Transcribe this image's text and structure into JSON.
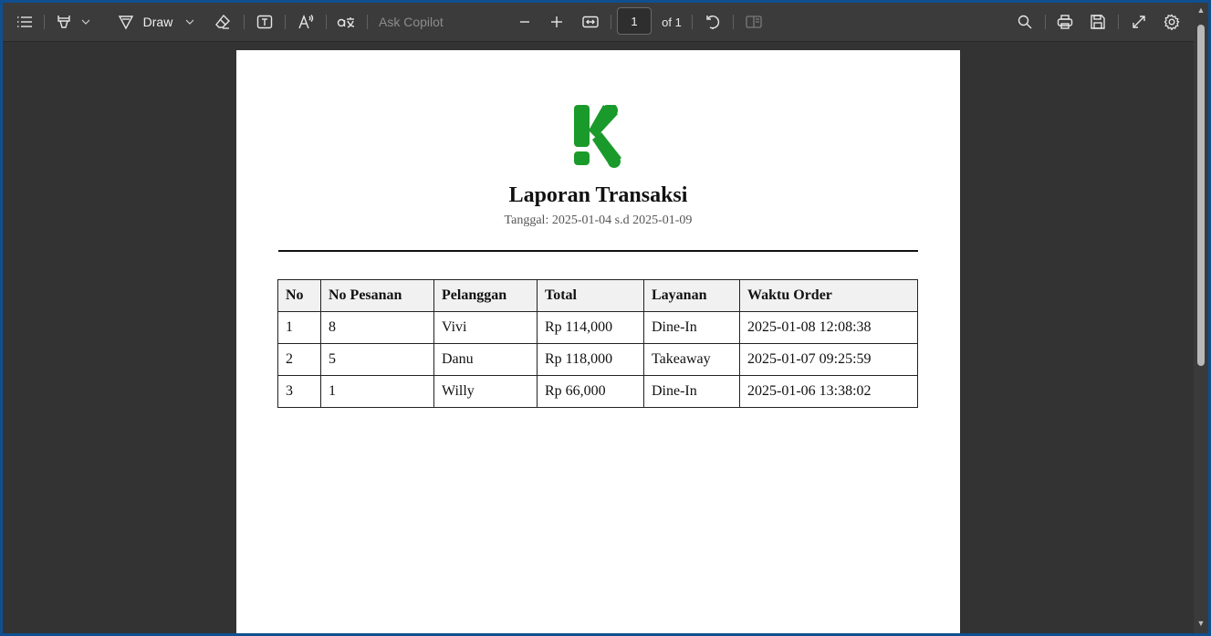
{
  "toolbar": {
    "draw_label": "Draw",
    "ask_copilot_label": "Ask Copilot",
    "page_number": "1",
    "page_total_label": "of 1"
  },
  "document": {
    "title": "Laporan Transaksi",
    "date_range": "Tanggal: 2025-01-04 s.d 2025-01-09",
    "logo_color": "#1a9a2a",
    "table": {
      "headers": [
        "No",
        "No Pesanan",
        "Pelanggan",
        "Total",
        "Layanan",
        "Waktu Order"
      ],
      "rows": [
        [
          "1",
          "8",
          "Vivi",
          "Rp 114,000",
          "Dine-In",
          "2025-01-08 12:08:38"
        ],
        [
          "2",
          "5",
          "Danu",
          "Rp 118,000",
          "Takeaway",
          "2025-01-07 09:25:59"
        ],
        [
          "3",
          "1",
          "Willy",
          "Rp 66,000",
          "Dine-In",
          "2025-01-06 13:38:02"
        ]
      ]
    }
  },
  "colors": {
    "window_border": "#0f4f8f",
    "toolbar_bg": "#3b3b3b",
    "viewer_bg": "#333333",
    "page_bg": "#ffffff"
  }
}
